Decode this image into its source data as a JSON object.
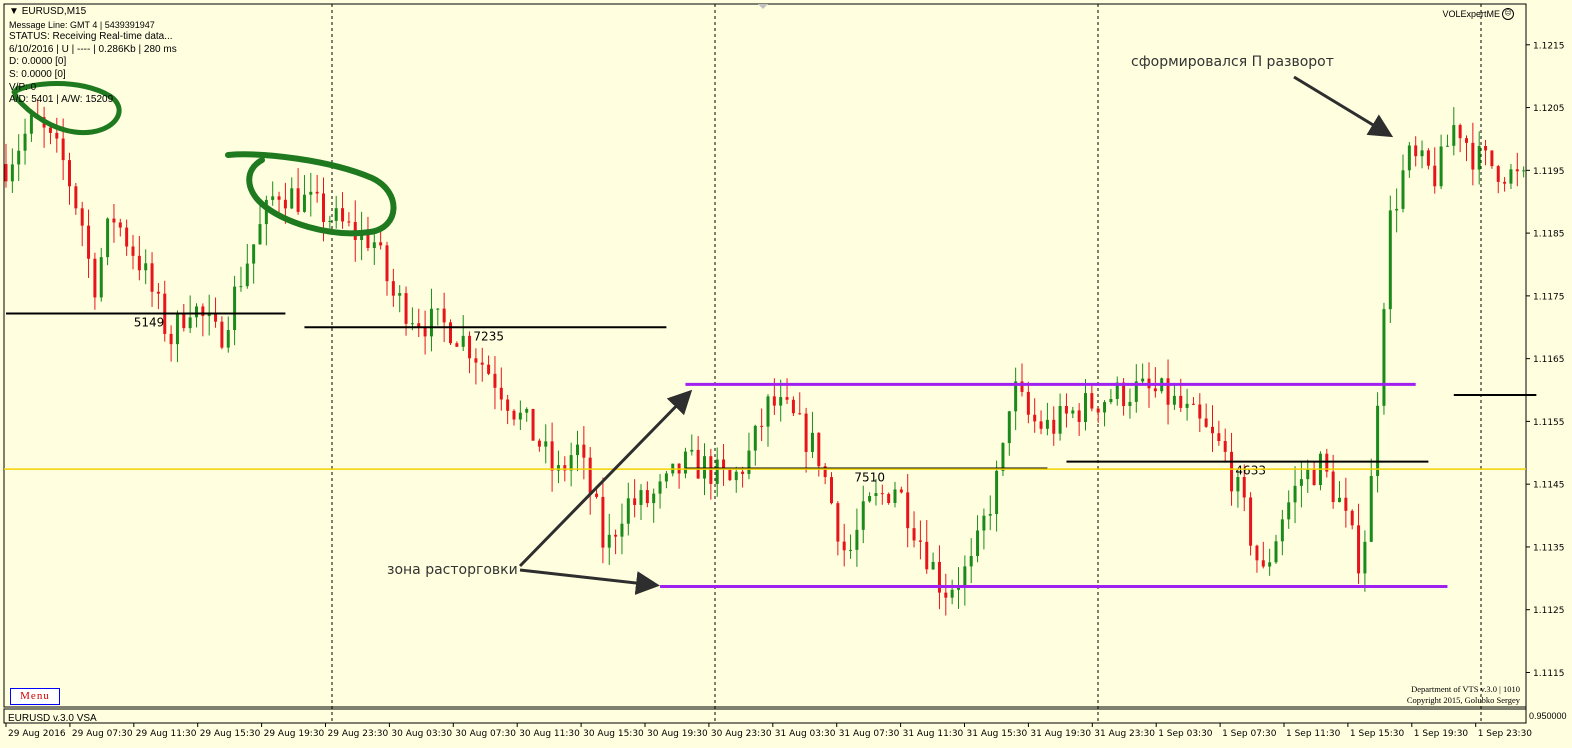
{
  "window": {
    "symbol_title": "EURUSD,M15",
    "message_line": "Message Line: GMT 4 | 5439391947",
    "status": "STATUS:  Receiving Real-time data...",
    "info_line": "6/10/2016 | U | ---- | 0.286Kb | 280 ms",
    "d_line": "D: 0.0000  [0]",
    "s_line": "S: 0.0000  [0]",
    "vp_line": "V/P: 0",
    "ad_line": "A/D: 5401 | A/W: 15209",
    "brand": "VOLExpertME",
    "menu_label": "Menu",
    "indicator_label": "EURUSD  v.3.0 VSA",
    "credit_line1": "Department of VTS  v.3.0 | 1010",
    "credit_line2": "Copyright 2015, Golubko Sergey",
    "sub_axis_value": "0.950000"
  },
  "chart_data": {
    "type": "candlestick",
    "symbol": "EURUSD",
    "timeframe": "M15",
    "ylim": [
      1.11095,
      1.12215
    ],
    "yticks": [
      "1.1215",
      "1.1205",
      "1.1195",
      "1.1185",
      "1.1175",
      "1.1165",
      "1.1155",
      "1.1145",
      "1.1135",
      "1.1125",
      "1.1115"
    ],
    "xticks": [
      "29 Aug 2016",
      "29 Aug 07:30",
      "29 Aug 11:30",
      "29 Aug 15:30",
      "29 Aug 19:30",
      "29 Aug 23:30",
      "30 Aug 03:30",
      "30 Aug 07:30",
      "30 Aug 11:30",
      "30 Aug 15:30",
      "30 Aug 19:30",
      "30 Aug 23:30",
      "31 Aug 03:30",
      "31 Aug 07:30",
      "31 Aug 11:30",
      "31 Aug 15:30",
      "31 Aug 19:30",
      "31 Aug 23:30",
      "1 Sep 03:30",
      "1 Sep 07:30",
      "1 Sep 11:30",
      "1 Sep 15:30",
      "1 Sep 19:30",
      "1 Sep 23:30"
    ],
    "up_color": "#1a8a1a",
    "down_color": "#e8141b",
    "price_path": [
      [
        0,
        1.1196
      ],
      [
        3,
        1.1203
      ],
      [
        6,
        1.1196
      ],
      [
        8,
        1.1186
      ],
      [
        9,
        1.1176
      ],
      [
        11,
        1.1188
      ],
      [
        14,
        1.118
      ],
      [
        17,
        1.1168
      ],
      [
        19,
        1.1174
      ],
      [
        22,
        1.1168
      ],
      [
        25,
        1.1181
      ],
      [
        28,
        1.1192
      ],
      [
        31,
        1.119
      ],
      [
        34,
        1.1187
      ],
      [
        36,
        1.1185
      ],
      [
        38,
        1.1184
      ],
      [
        40,
        1.1175
      ],
      [
        43,
        1.1171
      ],
      [
        46,
        1.117
      ],
      [
        48,
        1.1167
      ],
      [
        51,
        1.1161
      ],
      [
        53,
        1.1156
      ],
      [
        55,
        1.1152
      ],
      [
        57,
        1.1146
      ],
      [
        59,
        1.1151
      ],
      [
        61,
        1.1141
      ],
      [
        62,
        1.1134
      ],
      [
        64,
        1.1142
      ],
      [
        66,
        1.1142
      ],
      [
        68,
        1.1144
      ],
      [
        70,
        1.1148
      ],
      [
        72,
        1.1148
      ],
      [
        75,
        1.1145
      ],
      [
        77,
        1.115
      ],
      [
        79,
        1.1158
      ],
      [
        81,
        1.1156
      ],
      [
        84,
        1.115
      ],
      [
        87,
        1.1133
      ],
      [
        89,
        1.1141
      ],
      [
        92,
        1.1145
      ],
      [
        95,
        1.1135
      ],
      [
        97,
        1.1128
      ],
      [
        100,
        1.1132
      ],
      [
        101,
        1.1138
      ],
      [
        103,
        1.1148
      ],
      [
        104,
        1.1161
      ],
      [
        106,
        1.1155
      ],
      [
        108,
        1.1154
      ],
      [
        111,
        1.1157
      ],
      [
        114,
        1.1159
      ],
      [
        117,
        1.116
      ],
      [
        120,
        1.1159
      ],
      [
        123,
        1.1155
      ],
      [
        126,
        1.115
      ],
      [
        128,
        1.1141
      ],
      [
        130,
        1.113
      ],
      [
        132,
        1.114
      ],
      [
        134,
        1.1146
      ],
      [
        136,
        1.1148
      ],
      [
        138,
        1.1142
      ],
      [
        139,
        1.1137
      ],
      [
        140,
        1.1133
      ],
      [
        141,
        1.114
      ],
      [
        142,
        1.1162
      ],
      [
        143,
        1.1186
      ],
      [
        145,
        1.1197
      ],
      [
        148,
        1.1194
      ],
      [
        150,
        1.1203
      ],
      [
        152,
        1.1197
      ],
      [
        155,
        1.1195
      ],
      [
        157,
        1.1193
      ]
    ],
    "horizontal_lines": [
      {
        "label": "5149",
        "price": 1.11722,
        "from": 0,
        "to": 44,
        "color": "#000000"
      },
      {
        "label": "7235",
        "price": 1.117,
        "from": 47,
        "to": 104,
        "color": "#000000"
      },
      {
        "label": "7510",
        "price": 1.11475,
        "from": 107,
        "to": 164,
        "color": "#000000"
      },
      {
        "label": "4633",
        "price": 1.11486,
        "from": 167,
        "to": 224,
        "color": "#000000"
      },
      {
        "label": "",
        "price": 1.11592,
        "from": 228,
        "to": 241,
        "color": "#000000"
      },
      {
        "label": "",
        "price": 1.11474,
        "from": 0,
        "to": 241,
        "color": "#f2d200"
      },
      {
        "label": "",
        "price": 1.11609,
        "from": 107,
        "to": 222,
        "color": "#a020f0"
      },
      {
        "label": "",
        "price": 1.11287,
        "from": 103,
        "to": 227,
        "color": "#a020f0"
      }
    ],
    "annotations": [
      {
        "text": "зона расторговки"
      },
      {
        "text": "сформировался П разворот"
      }
    ]
  }
}
